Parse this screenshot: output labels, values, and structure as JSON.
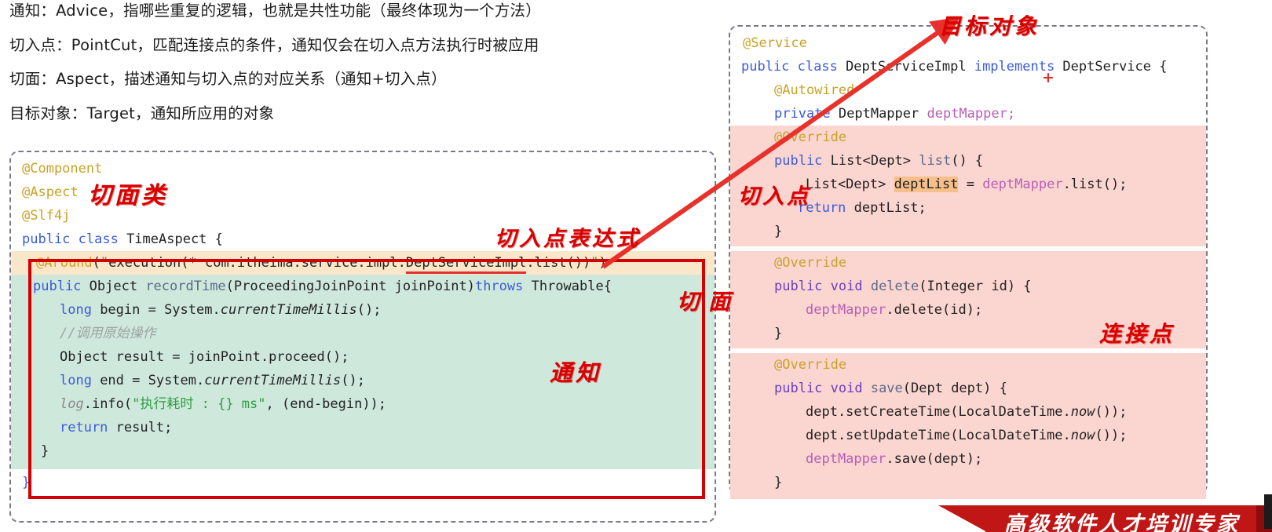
{
  "concepts": [
    "通知：Advice，指哪些重复的逻辑，也就是共性功能（最终体现为一个方法）",
    "切入点：PointCut，匹配连接点的条件，通知仅会在切入点方法执行时被应用",
    "切面：Aspect，描述通知与切入点的对应关系（通知+切入点）",
    "目标对象：Target，通知所应用的对象"
  ],
  "left_panel": {
    "title": "TimeAspect",
    "lines": {
      "l1": "@Component",
      "l2": "@Aspect",
      "l3": "@Slf4j",
      "l4_kw": "public class",
      "l4_name": " TimeAspect {",
      "l5_ann": "@Around",
      "l5_open": "(",
      "l5_q1": "\"",
      "l5_exec": "execution(* com.itheima.service.impl.",
      "l5_target": "DeptServiceImpl",
      "l5_rest": ".list())",
      "l5_q2": "\"",
      "l5_close": ")",
      "l6_kw": "public",
      "l6_type": " Object ",
      "l6_fn": "recordTime",
      "l6_args": "(ProceedingJoinPoint joinPoint)",
      "l6_throws": "throws",
      "l6_ex": " Throwable{",
      "l7_kw": "long",
      "l7_rest": " begin = System.",
      "l7_call": "currentTimeMillis",
      "l7_end": "();",
      "l8_comment": "//调用原始操作",
      "l9": "Object result = joinPoint.proceed();",
      "l10_kw": "long",
      "l10_rest": " end = System.",
      "l10_call": "currentTimeMillis",
      "l10_end": "();",
      "l11_log": "log",
      "l11_mid": ".info(",
      "l11_str": "\"执行耗时 : {} ms\"",
      "l11_end": ", (end-begin));",
      "l12_kw": "return",
      "l12_rest": " result;",
      "l13": "}",
      "l14": "}"
    }
  },
  "right_panel": {
    "title": "DeptServiceImpl",
    "lines": {
      "r1": "@Service",
      "r2_kw": "public class",
      "r2_name": " DeptServiceImpl ",
      "r2_impl": "implements",
      "r2_iface": " DeptService {",
      "r3": "@Autowired",
      "r4_kw": "private",
      "r4_type": " DeptMapper ",
      "r4_field": "deptMapper;",
      "r5": "@Override",
      "r6_kw": "public",
      "r6_type": " List<Dept> ",
      "r6_fn": "list",
      "r6_end": "() {",
      "r7_type": "List<Dept> ",
      "r7_var": "deptList",
      "r7_mid": " = ",
      "r7_call": "deptMapper",
      "r7_end": ".list();",
      "r8_kw": "return",
      "r8_rest": " deptList;",
      "r9": "}",
      "r10": "@Override",
      "r11_kw": "public void",
      "r11_fn": " delete",
      "r11_args": "(Integer id) {",
      "r12_obj": "deptMapper",
      "r12_rest": ".delete(id);",
      "r13": "}",
      "r14": "@Override",
      "r15_kw": "public void",
      "r15_fn": " save",
      "r15_args": "(Dept dept) {",
      "r16_pre": "dept.setCreateTime(LocalDateTime.",
      "r16_now": "now",
      "r16_end": "());",
      "r17_pre": "dept.setUpdateTime(LocalDateTime.",
      "r17_now": "now",
      "r17_end": "());",
      "r18_obj": "deptMapper",
      "r18_rest": ".save(dept);",
      "r19": "}"
    }
  },
  "annotations": {
    "aspect_class": "切面类",
    "pointcut_expression": "切入点表达式",
    "advice": "通知",
    "aspect": "切面",
    "target_object": "目标对象",
    "pointcut": "切入点",
    "join_point": "连接点",
    "plus": "+"
  },
  "banner": {
    "text": "高级软件人才培训专家"
  },
  "colors": {
    "advice_highlight": "#cfe8dc",
    "pointcut_highlight": "#fbd5d0",
    "expression_highlight": "#fae6c8",
    "var_highlight": "#f7c08a",
    "annotation_red": "#d90000",
    "box_border_red": "#d40000",
    "banner_red": "#c01616"
  }
}
